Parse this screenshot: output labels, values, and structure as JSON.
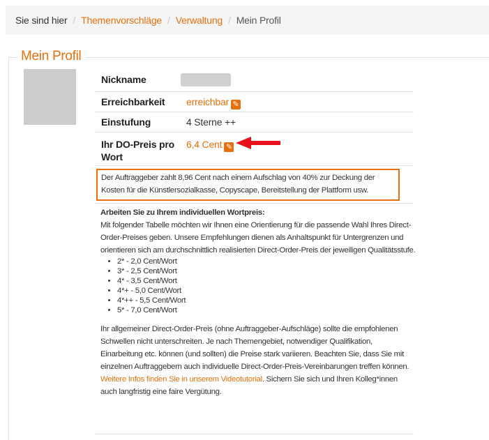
{
  "breadcrumb": {
    "prefix": "Sie sind hier",
    "separator": "/",
    "items": [
      "Themenvorschläge",
      "Verwaltung"
    ],
    "current": "Mein Profil"
  },
  "section": {
    "title": "Mein Profil"
  },
  "profile": {
    "nickname_label": "Nickname",
    "reachability_label": "Erreichbarkeit",
    "reachability_value": "erreichbar",
    "rating_label": "Einstufung",
    "rating_value": "4 Sterne ++",
    "price_label_line1": "Ihr DO-Preis pro",
    "price_label_line2": "Wort",
    "price_value": "6,4 Cent"
  },
  "notice": {
    "text": "Der Auftraggeber zahlt 8,96 Cent nach einem Aufschlag von 40% zur Deckung der Kosten für die Künstlersozialkasse, Copyscape, Bereitstellung der Plattform usw."
  },
  "info": {
    "heading": "Arbeiten Sie zu Ihrem individuellen Wortpreis:",
    "intro": "Mit folgender Tabelle möchten wir Ihnen eine Orientierung für die passende Wahl Ihres Direct-Order-Preises geben. Unsere Empfehlungen dienen als Anhaltspunkt für Untergrenzen und orientieren sich am durchschnittlich realisierten Direct-Order-Preis der jeweiligen Qualitätsstufe.",
    "price_list": [
      "2* - 2,0 Cent/Wort",
      "3* - 2,5 Cent/Wort",
      "4* - 3,5 Cent/Wort",
      "4*+ - 5,0 Cent/Wort",
      "4*++ - 5,5 Cent/Wort",
      "5* - 7,0 Cent/Wort"
    ],
    "outro_before_link": "Ihr allgemeiner Direct-Order-Preis (ohne Auftraggeber-Aufschläge) sollte die empfohlenen Schwellen nicht unterschreiten. Je nach Themengebiet, notwendiger Qualifikation, Einarbeitung etc. können (und sollten) die Preise stark variieren. Beachten Sie, dass Sie mit einzelnen Auftraggebern auch individuelle Direct-Order-Preis-Vereinbarungen treffen können. ",
    "link_text": "Weitere Infos finden Sie in unserem Videotutorial",
    "outro_after_link": ". Sichern Sie sich und Ihren Kolleg*innen auch langfristig eine faire Vergütung."
  },
  "colors": {
    "accent": "#e8700c",
    "arrow": "#e8101a"
  },
  "icons": {
    "edit": "pencil-icon",
    "arrow": "red-arrow-icon"
  }
}
